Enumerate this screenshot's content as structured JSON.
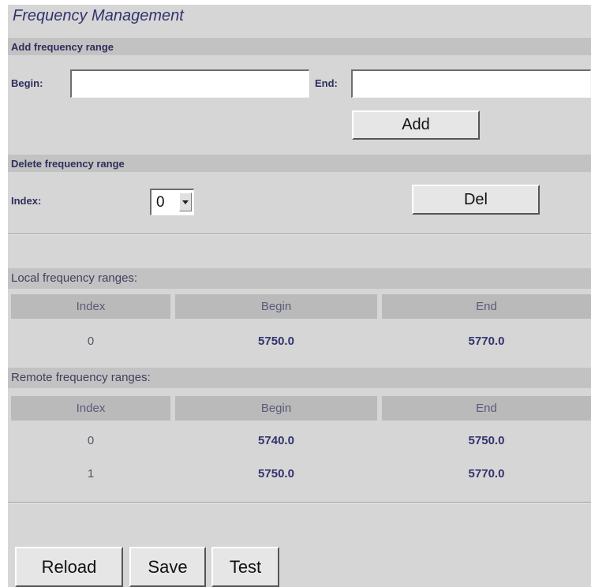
{
  "page_title": "Frequency Management",
  "add_section": {
    "title": "Add frequency range",
    "begin_label": "Begin:",
    "begin_value": "",
    "end_label": "End:",
    "end_value": "",
    "add_button": "Add"
  },
  "delete_section": {
    "title": "Delete frequency range",
    "index_label": "Index:",
    "index_selected": "0",
    "del_button": "Del"
  },
  "local_table": {
    "title": "Local frequency ranges:",
    "headers": [
      "Index",
      "Begin",
      "End"
    ],
    "rows": [
      [
        "0",
        "5750.0",
        "5770.0"
      ]
    ]
  },
  "remote_table": {
    "title": "Remote frequency ranges:",
    "headers": [
      "Index",
      "Begin",
      "End"
    ],
    "rows": [
      [
        "0",
        "5740.0",
        "5750.0"
      ],
      [
        "1",
        "5750.0",
        "5770.0"
      ]
    ]
  },
  "footer": {
    "reload_button": "Reload",
    "save_button": "Save",
    "test_button": "Test"
  }
}
